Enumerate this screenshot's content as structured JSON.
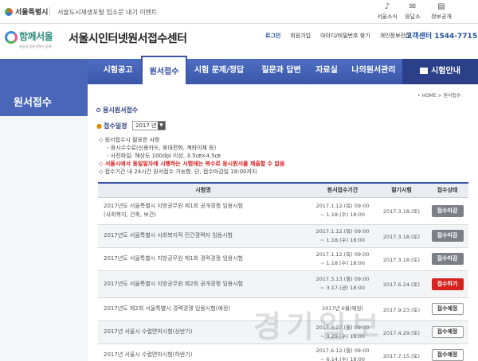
{
  "topbar": {
    "logo_text": "서울특별시",
    "notice_text": "서울도시재생포털 입소문 내기 이벤트",
    "utils": [
      {
        "label": "서울소식",
        "icon": "bell-icon"
      },
      {
        "label": "응답소",
        "icon": "chat-icon"
      },
      {
        "label": "정보공개",
        "icon": "document-icon"
      }
    ]
  },
  "header": {
    "brand_text": "함께서울",
    "brand_sub": "희망과 함께 행복이 함께",
    "site_title": "서울시인터넷원서접수센터",
    "links": [
      "로그인",
      "회원가입",
      "아이디/비밀번호 찾기",
      "개인정보관리"
    ],
    "callcenter": "고객센터 1544-7715"
  },
  "nav": {
    "tabs": [
      "시험공고",
      "원서접수",
      "시험 문제/정답",
      "질문과 답변",
      "자료실",
      "나의원서관리"
    ],
    "active_index": 1,
    "guide": "시험안내"
  },
  "side": {
    "title": "원서접수"
  },
  "content": {
    "breadcrumb": "• HOME > 원서접수",
    "section_title": "응시원서접수",
    "filter_label": "접수일정",
    "filter_value": "2017 년",
    "notes": [
      {
        "text": "◇ 원서접수시 필요한 사항",
        "style": "normal"
      },
      {
        "text": "- 응시수수료(신용카드, 휴대전화, 계좌이체 등)",
        "style": "indent"
      },
      {
        "text": "- 사진파일: 해상도 100dpi 이상, 3.5㎝×4.5㎝",
        "style": "indent"
      },
      {
        "text": "◇ 서울시에서 동일일자에 시행하는 시험에는 복수로 응시원서를 제출할 수 없음",
        "style": "red"
      },
      {
        "text": "◇ 접수기간 내 24시간 원서접수 가능함. 단, 접수마감일 18:00까지",
        "style": "normal"
      }
    ],
    "table": {
      "headers": [
        "시험명",
        "원서접수기간",
        "필기시험",
        "접수상태"
      ],
      "rows": [
        {
          "name_line1": "2017년도 서울특별시 지방공무원 제1회 공개경쟁 임용시험",
          "name_line2": "(사회복지, 건축, 보건)",
          "period_line1": "2017.1.12.(목) 09:00",
          "period_line2": "~ 1.18.(수) 18:00",
          "exam_date": "2017.3.18.(토)",
          "status": "접수마감",
          "variant": "gray"
        },
        {
          "name_line1": "2017년도 서울특별시 사회복지직 민간경력자 임용시험",
          "name_line2": "",
          "period_line1": "2017.1.12.(목) 09:00",
          "period_line2": "~ 1.18.(수) 18:00",
          "exam_date": "2017.3.18.(토)",
          "status": "접수마감",
          "variant": "gray"
        },
        {
          "name_line1": "2017년도 서울특별시 지방공무원 제1회 경력경쟁 임용시험",
          "name_line2": "",
          "period_line1": "2017.1.12.(목) 09:00",
          "period_line2": "~ 1.18.(수) 18:00",
          "exam_date": "2017.3.18.(토)",
          "status": "접수마감",
          "variant": "gray"
        },
        {
          "name_line1": "2017년도 서울특별시 지방공무원 제2회 공개경쟁 임용시험",
          "name_line2": "",
          "period_line1": "2017.3.13.(월) 09:00",
          "period_line2": "~ 3.17.(금) 18:00",
          "exam_date": "2017.6.24.(토)",
          "status": "접수하기",
          "variant": "red"
        },
        {
          "name_line1": "2017년도 제2회 서울특별시 경력경쟁 임용시험(예정)",
          "name_line2": "",
          "period_line1": "2017년 6월(예정)",
          "period_line2": "",
          "exam_date": "2017.9.23.(토)",
          "status": "접수예정",
          "variant": "white"
        },
        {
          "name_line1": "2017년 서울시 수렵면허시험(상반기)",
          "name_line2": "",
          "period_line1": "2017.3.27.(월) 09:00",
          "period_line2": "~ 3.29.(수) 18:00",
          "exam_date": "2017.4.29.(토)",
          "status": "접수예정",
          "variant": "white"
        },
        {
          "name_line1": "2017년 서울시 수렵면허시험(하반기)",
          "name_line2": "",
          "period_line1": "2017.6.12.(월) 09:00",
          "period_line2": "~ 6.14.(수) 18:00",
          "exam_date": "2017.7.15.(토)",
          "status": "접수예정",
          "variant": "white"
        }
      ]
    },
    "watermark": "경기일보"
  }
}
